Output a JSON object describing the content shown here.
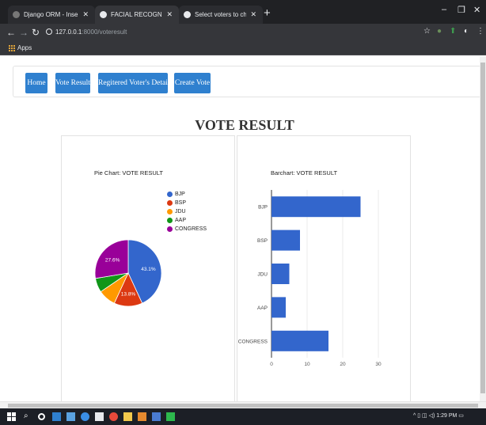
{
  "browser": {
    "tabs": [
      {
        "label": "Django ORM - Inserting, Updatin"
      },
      {
        "label": "FACIAL RECOGNITION BASED VO"
      },
      {
        "label": "Select voters to change | Django"
      }
    ],
    "address": {
      "host": "127.0.0.1",
      "path": ":8000/voteresult"
    },
    "bookmarks": {
      "apps_label": "Apps"
    }
  },
  "nav": {
    "links": [
      "Home",
      "Vote Result",
      "Regitered Voter's Details",
      "Create Vote"
    ]
  },
  "page": {
    "title": "VOTE RESULT"
  },
  "pie_title": "Pie Chart: VOTE RESULT",
  "bar_title": "Barchart: VOTE RESULT",
  "legend": [
    "BJP",
    "BSP",
    "JDU",
    "AAP",
    "CONGRESS"
  ],
  "colors": {
    "BJP": "#3366cc",
    "BSP": "#dc3912",
    "JDU": "#ff9900",
    "AAP": "#109618",
    "CONGRESS": "#990099",
    "nav_button": "#2f80cf"
  },
  "taskbar": {
    "time": "1:29 PM"
  },
  "chart_data": [
    {
      "type": "pie",
      "title": "Pie Chart: VOTE RESULT",
      "categories": [
        "BJP",
        "BSP",
        "JDU",
        "AAP",
        "CONGRESS"
      ],
      "values": [
        25,
        8,
        5,
        4,
        16
      ],
      "labels": [
        "43.1%",
        "13.8%",
        "",
        "",
        "27.6%"
      ],
      "legend_position": "right"
    },
    {
      "type": "bar",
      "orientation": "horizontal",
      "title": "Barchart: VOTE RESULT",
      "categories": [
        "BJP",
        "BSP",
        "JDU",
        "AAP",
        "CONGRESS"
      ],
      "values": [
        25,
        8,
        5,
        4,
        16
      ],
      "xticks": [
        0,
        10,
        20,
        30
      ],
      "xlim": [
        0,
        30
      ],
      "grid": true
    }
  ]
}
